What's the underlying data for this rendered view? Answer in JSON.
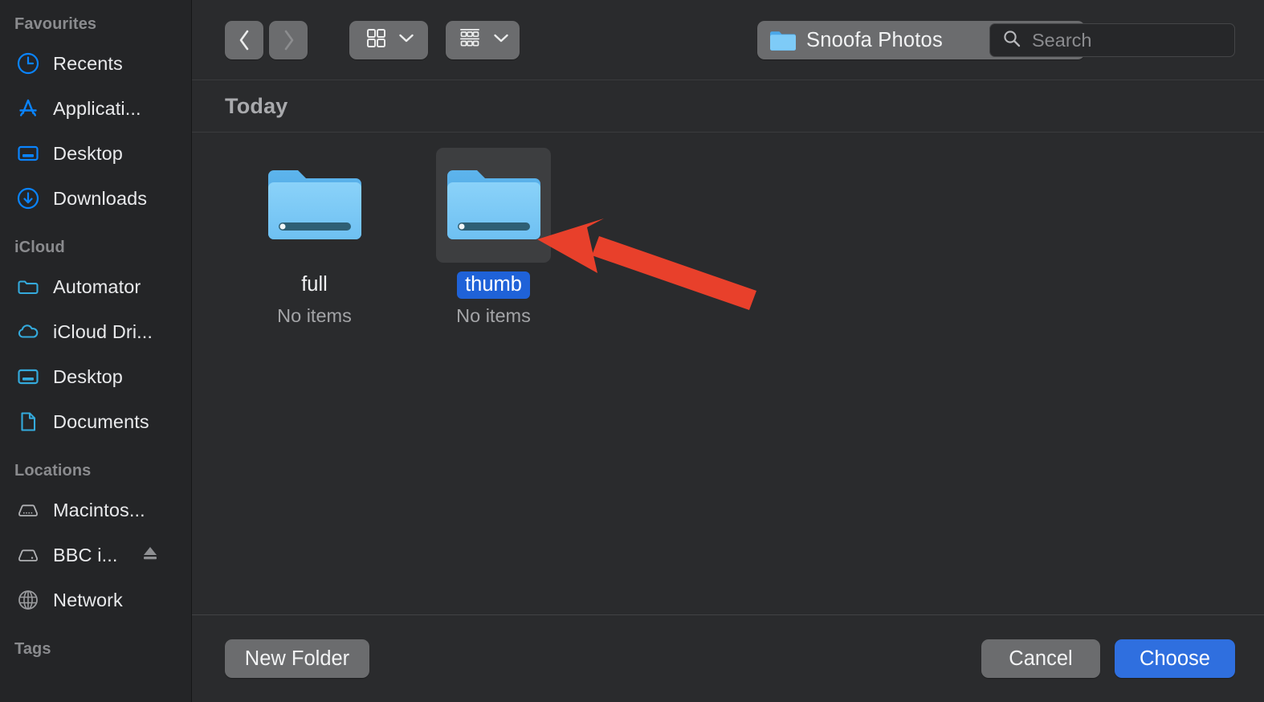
{
  "sidebar": {
    "sections": [
      {
        "title": "Favourites",
        "items": [
          {
            "label": "Recents",
            "icon": "clock-icon",
            "tint": "#0a84ff"
          },
          {
            "label": "Applicati...",
            "icon": "app-store-icon",
            "tint": "#0a84ff"
          },
          {
            "label": "Desktop",
            "icon": "desktop-icon",
            "tint": "#0a84ff"
          },
          {
            "label": "Downloads",
            "icon": "download-circle-icon",
            "tint": "#0a84ff"
          }
        ]
      },
      {
        "title": "iCloud",
        "items": [
          {
            "label": "Automator",
            "icon": "folder-outline-icon",
            "tint": "#34aadc"
          },
          {
            "label": "iCloud Dri...",
            "icon": "cloud-icon",
            "tint": "#34aadc"
          },
          {
            "label": "Desktop",
            "icon": "desktop-icon",
            "tint": "#34aadc"
          },
          {
            "label": "Documents",
            "icon": "document-icon",
            "tint": "#34aadc"
          }
        ]
      },
      {
        "title": "Locations",
        "items": [
          {
            "label": "Macintos...",
            "icon": "internal-drive-icon",
            "tint": "#b0b1b4"
          },
          {
            "label": "BBC i...",
            "icon": "external-drive-icon",
            "tint": "#b0b1b4",
            "eject": "eject-icon"
          },
          {
            "label": "Network",
            "icon": "globe-icon",
            "tint": "#b0b1b4"
          }
        ]
      },
      {
        "title": "Tags",
        "items": []
      }
    ]
  },
  "toolbar": {
    "back_label": "Back",
    "forward_label": "Forward",
    "view_icon": "grid-view-icon",
    "group_icon": "group-by-icon",
    "path": {
      "folder_icon": "folder-icon",
      "label": "Snoofa Photos",
      "stepper_icon": "up-down-chevron-icon"
    },
    "search": {
      "icon": "search-icon",
      "placeholder": "Search",
      "value": ""
    }
  },
  "main": {
    "group_header": "Today",
    "files": [
      {
        "name": "full",
        "subtitle": "No items",
        "icon": "folder-icon",
        "selected": false
      },
      {
        "name": "thumb",
        "subtitle": "No items",
        "icon": "folder-icon",
        "selected": true
      }
    ]
  },
  "footer": {
    "new_folder_label": "New Folder",
    "cancel_label": "Cancel",
    "choose_label": "Choose"
  },
  "annotation": {
    "arrow_color": "#e8402b",
    "points_to": "thumb"
  },
  "colors": {
    "sidebar_bg": "#242527",
    "content_bg": "#2a2b2d",
    "accent_blue": "#0a84ff",
    "selection_blue": "#1f62d8",
    "default_button_blue": "#2f6fdf",
    "folder_blue": "#6fc2f5"
  }
}
